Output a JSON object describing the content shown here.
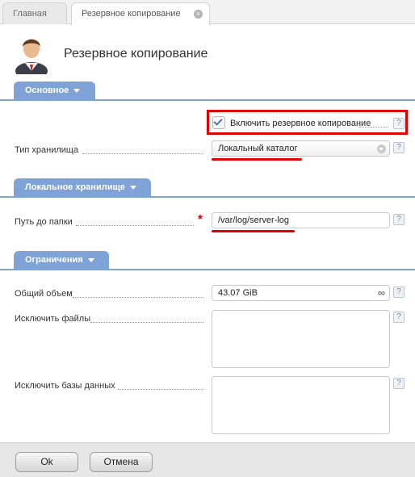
{
  "tabs": [
    {
      "label": "Главная"
    },
    {
      "label": "Резервное копирование"
    }
  ],
  "page_title": "Резервное копирование",
  "sections": {
    "main": {
      "title": "Основное"
    },
    "local": {
      "title": "Локальное хранилище"
    },
    "limits": {
      "title": "Ограничения"
    }
  },
  "fields": {
    "enable_backup": {
      "label": "Включить резервное копирование",
      "checked": true
    },
    "storage_type": {
      "label": "Тип хранилища",
      "value": "Локальный каталог"
    },
    "folder_path": {
      "label": "Путь до папки",
      "value": "/var/log/server-log",
      "required_mark": "*"
    },
    "total_size": {
      "label": "Общий объем",
      "value": "43.07 GiB"
    },
    "exclude_files": {
      "label": "Исключить файлы",
      "value": ""
    },
    "exclude_databases": {
      "label": "Исключить базы данных",
      "value": ""
    }
  },
  "help_glyph": "?",
  "infinity_glyph": "∞",
  "close_glyph": "×",
  "buttons": {
    "ok": "Ok",
    "cancel": "Отмена"
  },
  "colors": {
    "section_accent": "#7fa3d6",
    "highlight_red": "#e00000",
    "check_blue": "#4a79bd"
  }
}
